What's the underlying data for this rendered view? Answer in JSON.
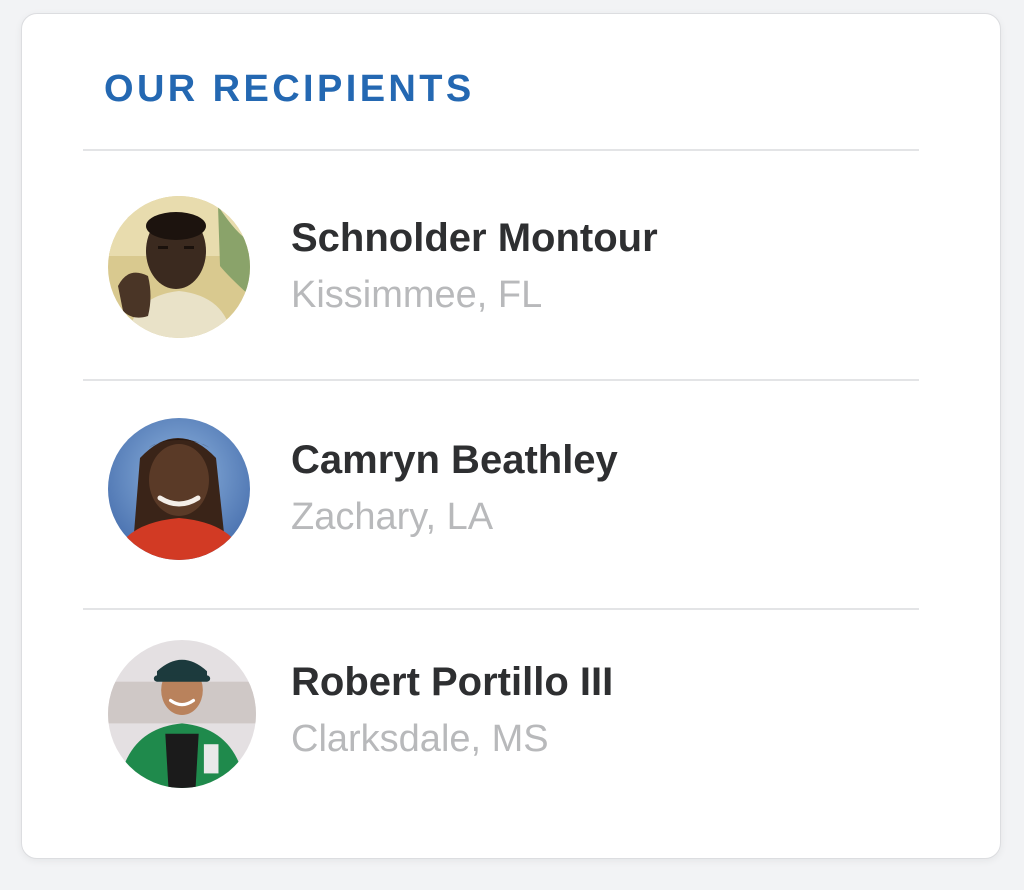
{
  "section": {
    "title": "OUR RECIPIENTS"
  },
  "recipients": [
    {
      "name": "Schnolder Montour",
      "location": "Kissimmee, FL",
      "avatar": "avatar-photo"
    },
    {
      "name": "Camryn Beathley",
      "location": "Zachary, LA",
      "avatar": "avatar-photo"
    },
    {
      "name": "Robert Portillo III",
      "location": "Clarksdale, MS",
      "avatar": "avatar-photo"
    }
  ],
  "colors": {
    "title": "#2468b2",
    "name": "#2e2f31",
    "location": "#b8b9bb",
    "divider": "#e3e4e6"
  }
}
